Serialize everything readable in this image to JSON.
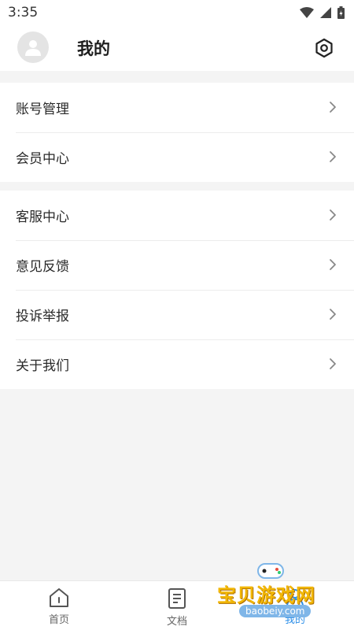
{
  "status_bar": {
    "time": "3:35"
  },
  "header": {
    "title": "我的"
  },
  "groups": {
    "account": [
      {
        "label": "账号管理"
      },
      {
        "label": "会员中心"
      }
    ],
    "support": [
      {
        "label": "客服中心"
      },
      {
        "label": "意见反馈"
      },
      {
        "label": "投诉举报"
      },
      {
        "label": "关于我们"
      }
    ]
  },
  "tabs": [
    {
      "label": "首页",
      "icon": "home-icon"
    },
    {
      "label": "文档",
      "icon": "document-icon"
    },
    {
      "label": "我的",
      "icon": "user-icon",
      "active": true
    }
  ],
  "watermark": {
    "text": "宝贝游戏网",
    "url": "baobeiy.com"
  },
  "colors": {
    "accent": "#2b8ee8",
    "background": "#f4f4f4",
    "surface": "#ffffff"
  }
}
